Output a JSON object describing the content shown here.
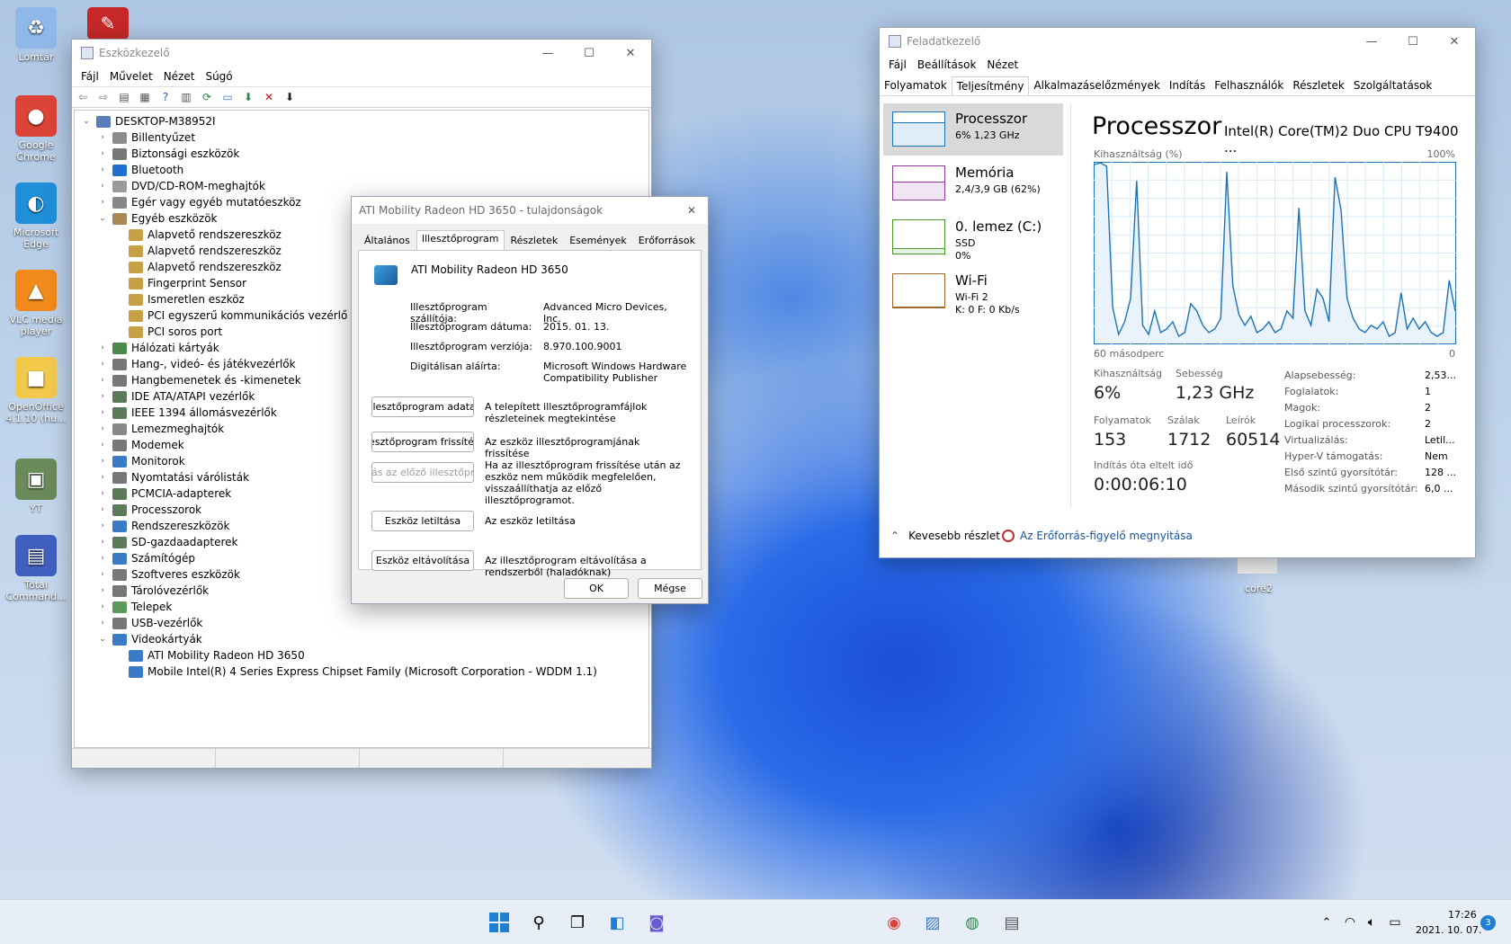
{
  "desktop": {
    "icons": [
      {
        "label": "Lomtár",
        "glyph": "♻",
        "color": "#8fb7e8",
        "top": 8
      },
      {
        "label": "Google Chrome",
        "glyph": "●",
        "color": "#db4437",
        "top": 106
      },
      {
        "label": "Microsoft Edge",
        "glyph": "◐",
        "color": "#1f8fd9",
        "top": 203
      },
      {
        "label": "VLC media player",
        "glyph": "▲",
        "color": "#f28a1b",
        "top": 300
      },
      {
        "label": "OpenOffice 4.1.10 (hu...",
        "glyph": "■",
        "color": "#f2c94a",
        "top": 397
      },
      {
        "label": "YT",
        "glyph": "▣",
        "color": "#6a8a5a",
        "top": 510
      },
      {
        "label": "Total Command...",
        "glyph": "▤",
        "color": "#4060c0",
        "top": 595
      }
    ],
    "pdf_icon": "pdf-icon",
    "core2_label": "core2"
  },
  "devmgr": {
    "title": "Eszközkezelő",
    "menu": [
      "Fájl",
      "Művelet",
      "Nézet",
      "Súgó"
    ],
    "toolbar_icons": [
      "back-icon",
      "forward-icon",
      "properties-icon",
      "list-icon",
      "help-icon",
      "view-icon",
      "scan-icon",
      "monitor-icon",
      "enable-icon",
      "uninstall-icon",
      "update-icon"
    ],
    "tree": [
      {
        "label": "DESKTOP-M38952I",
        "level": 0,
        "exp": "open",
        "icon": "#5a7cb8"
      },
      {
        "label": "Billentyűzet",
        "level": 1,
        "exp": "closed",
        "icon": "#8c8c8c"
      },
      {
        "label": "Biztonsági eszközök",
        "level": 1,
        "exp": "closed",
        "icon": "#777"
      },
      {
        "label": "Bluetooth",
        "level": 1,
        "exp": "closed",
        "icon": "#1e6fd0"
      },
      {
        "label": "DVD/CD-ROM-meghajtók",
        "level": 1,
        "exp": "closed",
        "icon": "#9a9a9a"
      },
      {
        "label": "Egér vagy egyéb mutatóeszköz",
        "level": 1,
        "exp": "closed",
        "icon": "#888"
      },
      {
        "label": "Egyéb eszközök",
        "level": 1,
        "exp": "open",
        "icon": "#aa8855"
      },
      {
        "label": "Alapvető rendszereszköz",
        "level": 2,
        "exp": "",
        "icon": "#c7a045"
      },
      {
        "label": "Alapvető rendszereszköz",
        "level": 2,
        "exp": "",
        "icon": "#c7a045"
      },
      {
        "label": "Alapvető rendszereszköz",
        "level": 2,
        "exp": "",
        "icon": "#c7a045"
      },
      {
        "label": "Fingerprint Sensor",
        "level": 2,
        "exp": "",
        "icon": "#c7a045"
      },
      {
        "label": "Ismeretlen eszköz",
        "level": 2,
        "exp": "",
        "icon": "#c7a045"
      },
      {
        "label": "PCI egyszerű kommunikációs vezérlő",
        "level": 2,
        "exp": "",
        "icon": "#c7a045"
      },
      {
        "label": "PCI soros port",
        "level": 2,
        "exp": "",
        "icon": "#c7a045"
      },
      {
        "label": "Hálózati kártyák",
        "level": 1,
        "exp": "closed",
        "icon": "#4a8a4a"
      },
      {
        "label": "Hang-, videó- és játékvezérlők",
        "level": 1,
        "exp": "closed",
        "icon": "#777"
      },
      {
        "label": "Hangbemenetek és -kimenetek",
        "level": 1,
        "exp": "closed",
        "icon": "#777"
      },
      {
        "label": "IDE ATA/ATAPI vezérlők",
        "level": 1,
        "exp": "closed",
        "icon": "#5a7a5a"
      },
      {
        "label": "IEEE 1394 állomásvezérlők",
        "level": 1,
        "exp": "closed",
        "icon": "#5a7a5a"
      },
      {
        "label": "Lemezmeghajtók",
        "level": 1,
        "exp": "closed",
        "icon": "#888"
      },
      {
        "label": "Modemek",
        "level": 1,
        "exp": "closed",
        "icon": "#777"
      },
      {
        "label": "Monitorok",
        "level": 1,
        "exp": "closed",
        "icon": "#3a7bc8"
      },
      {
        "label": "Nyomtatási várólisták",
        "level": 1,
        "exp": "closed",
        "icon": "#777"
      },
      {
        "label": "PCMCIA-adapterek",
        "level": 1,
        "exp": "closed",
        "icon": "#5a7a5a"
      },
      {
        "label": "Processzorok",
        "level": 1,
        "exp": "closed",
        "icon": "#5a7a5a"
      },
      {
        "label": "Rendszereszközök",
        "level": 1,
        "exp": "closed",
        "icon": "#3a7bc8"
      },
      {
        "label": "SD-gazdaadapterek",
        "level": 1,
        "exp": "closed",
        "icon": "#5a7a5a"
      },
      {
        "label": "Számítógép",
        "level": 1,
        "exp": "closed",
        "icon": "#3a7bc8"
      },
      {
        "label": "Szoftveres eszközök",
        "level": 1,
        "exp": "closed",
        "icon": "#777"
      },
      {
        "label": "Tárolóvezérlők",
        "level": 1,
        "exp": "closed",
        "icon": "#777"
      },
      {
        "label": "Telepek",
        "level": 1,
        "exp": "closed",
        "icon": "#5a9a5a"
      },
      {
        "label": "USB-vezérlők",
        "level": 1,
        "exp": "closed",
        "icon": "#777"
      },
      {
        "label": "Videokártyák",
        "level": 1,
        "exp": "open",
        "icon": "#3a7bc8"
      },
      {
        "label": "ATI Mobility Radeon HD 3650",
        "level": 2,
        "exp": "",
        "icon": "#3a7bc8"
      },
      {
        "label": "Mobile Intel(R) 4 Series Express Chipset Family (Microsoft Corporation - WDDM 1.1)",
        "level": 2,
        "exp": "",
        "icon": "#3a7bc8"
      }
    ]
  },
  "dialog": {
    "title": "ATI Mobility Radeon HD 3650 - tulajdonságok",
    "tabs": [
      "Általános",
      "Illesztőprogram",
      "Részletek",
      "Események",
      "Erőforrások"
    ],
    "active_tab": 1,
    "device_name": "ATI Mobility Radeon HD 3650",
    "props": [
      {
        "k": "Illesztőprogram szállítója:",
        "v": "Advanced Micro Devices, Inc."
      },
      {
        "k": "Illesztőprogram dátuma:",
        "v": "2015. 01. 13."
      },
      {
        "k": "Illesztőprogram verziója:",
        "v": "8.970.100.9001"
      },
      {
        "k": "Digitálisan aláírta:",
        "v": "Microsoft Windows Hardware Compatibility Publisher"
      }
    ],
    "actions": [
      {
        "btn": "Illesztőprogram adatai",
        "desc": "A telepített illesztőprogramfájlok részleteinek megtekintése",
        "disabled": false
      },
      {
        "btn": "Illesztőprogram frissítése",
        "desc": "Az eszköz illesztőprogramjának frissítése",
        "disabled": false
      },
      {
        "btn": "Visszaállás az előző illesztőprogramra",
        "desc": "Ha az illesztőprogram frissítése után az eszköz nem működik megfelelően, visszaállíthatja az előző illesztőprogramot.",
        "disabled": true
      },
      {
        "btn": "Eszköz letiltása",
        "desc": "Az eszköz letiltása",
        "disabled": false
      },
      {
        "btn": "Eszköz eltávolítása",
        "desc": "Az illesztőprogram eltávolítása a rendszerből (haladóknak)",
        "disabled": false
      }
    ],
    "ok": "OK",
    "cancel": "Mégse"
  },
  "taskmgr": {
    "title": "Feladatkezelő",
    "menu": [
      "Fájl",
      "Beállítások",
      "Nézet"
    ],
    "tabs": [
      "Folyamatok",
      "Teljesítmény",
      "Alkalmazáselőzmények",
      "Indítás",
      "Felhasználók",
      "Részletek",
      "Szolgáltatások"
    ],
    "active_tab": 1,
    "side": [
      {
        "name": "Processzor",
        "sub": [
          "6% 1,23 GHz"
        ],
        "color": "#1a73b8",
        "sel": true
      },
      {
        "name": "Memória",
        "sub": [
          "2,4/3,9 GB (62%)"
        ],
        "color": "#8b3a9a",
        "sel": false
      },
      {
        "name": "0. lemez (C:)",
        "sub": [
          "SSD",
          "0%"
        ],
        "color": "#4a9a2a",
        "sel": false
      },
      {
        "name": "Wi-Fi",
        "sub": [
          "Wi-Fi 2",
          "K: 0 F: 0 Kb/s"
        ],
        "color": "#a0682a",
        "sel": false
      }
    ],
    "heading": "Processzor",
    "cpu_name": "Intel(R) Core(TM)2 Duo CPU T9400 ...",
    "util_label": "Kihasználtság (%)",
    "pct_max": "100%",
    "time_left": "60 másodperc",
    "time_right": "0",
    "stats": [
      {
        "k": "Kihasználtság",
        "v": "6%"
      },
      {
        "k": "Sebesség",
        "v": "1,23 GHz"
      },
      {
        "k": "Folyamatok",
        "v": "153"
      },
      {
        "k": "Szálak",
        "v": "1712"
      },
      {
        "k": "Leírók",
        "v": "60514"
      },
      {
        "k": "Indítás óta eltelt idő",
        "v": "0:00:06:10"
      }
    ],
    "props": [
      {
        "k": "Alapsebesség:",
        "v": "2,53..."
      },
      {
        "k": "Foglalatok:",
        "v": "1"
      },
      {
        "k": "Magok:",
        "v": "2"
      },
      {
        "k": "Logikai processzorok:",
        "v": "2"
      },
      {
        "k": "Virtualizálás:",
        "v": "Letil..."
      },
      {
        "k": "Hyper-V támogatás:",
        "v": "Nem"
      },
      {
        "k": "Első szintű gyorsítótár:",
        "v": "128 ..."
      },
      {
        "k": "Második szintű gyorsítótár:",
        "v": "6,0 ..."
      }
    ],
    "fewer": "Kevesebb részlet",
    "resmon": "Az Erőforrás-figyelő megnyitása",
    "chart_data": {
      "type": "line",
      "ylim": [
        0,
        100
      ],
      "xlim": [
        0,
        60
      ],
      "x": [
        0,
        1,
        2,
        3,
        4,
        5,
        6,
        7,
        8,
        9,
        10,
        11,
        12,
        13,
        14,
        15,
        16,
        17,
        18,
        19,
        20,
        21,
        22,
        23,
        24,
        25,
        26,
        27,
        28,
        29,
        30,
        31,
        32,
        33,
        34,
        35,
        36,
        37,
        38,
        39,
        40,
        41,
        42,
        43,
        44,
        45,
        46,
        47,
        48,
        49,
        50,
        51,
        52,
        53,
        54,
        55,
        56,
        57,
        58,
        59,
        60
      ],
      "values": [
        99,
        100,
        98,
        20,
        5,
        12,
        25,
        90,
        10,
        5,
        18,
        6,
        8,
        12,
        4,
        6,
        22,
        18,
        10,
        6,
        8,
        14,
        95,
        32,
        16,
        10,
        15,
        6,
        8,
        12,
        6,
        8,
        18,
        14,
        75,
        18,
        10,
        30,
        25,
        12,
        92,
        74,
        25,
        14,
        8,
        6,
        10,
        8,
        12,
        4,
        6,
        28,
        8,
        14,
        8,
        12,
        6,
        4,
        6,
        35,
        18
      ]
    }
  },
  "taskbar": {
    "icons": [
      "windows-start-icon",
      "search-icon",
      "task-view-icon",
      "widgets-icon",
      "chat-icon"
    ],
    "apps": [
      "chrome-icon",
      "task-manager-icon",
      "control-panel-icon",
      "device-manager-icon"
    ],
    "tray": [
      "chevron-up-icon",
      "wifi-icon",
      "volume-icon",
      "battery-icon"
    ],
    "time": "17:26",
    "date": "2021. 10. 07.",
    "badge": "3"
  }
}
